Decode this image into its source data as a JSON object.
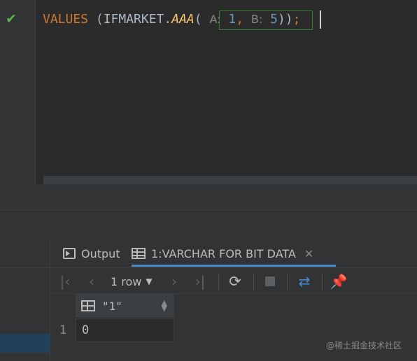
{
  "editor": {
    "code": {
      "keyword": "VALUES",
      "open": " (IFMARKET.",
      "function": "AAA",
      "paren": "(",
      "hint_a": "A:",
      "val_a": "1",
      "comma": ",",
      "hint_b": "B:",
      "val_b": "5",
      "close": "))",
      "semicolon": ";"
    },
    "status_icon": "checkmark-icon"
  },
  "tabs": {
    "output": "Output",
    "result": "1:VARCHAR FOR BIT DATA",
    "close_symbol": "✕"
  },
  "toolbar": {
    "rows": "1 row",
    "icons": [
      "first-page-icon",
      "prev-page-icon",
      "next-page-icon",
      "last-page-icon",
      "refresh-icon",
      "stop-icon",
      "compare-icon",
      "pin-icon"
    ]
  },
  "grid": {
    "columns": [
      "\"1\""
    ],
    "rows": [
      {
        "num": "1",
        "cells": [
          "0"
        ]
      }
    ]
  },
  "watermark": "@稀土掘金技术社区",
  "colors": {
    "background": "#2b2b2b",
    "keyword": "#cc7832",
    "function": "#ffc66d",
    "number": "#6897bb",
    "accent": "#4a88c7",
    "check": "#5fae4f"
  }
}
